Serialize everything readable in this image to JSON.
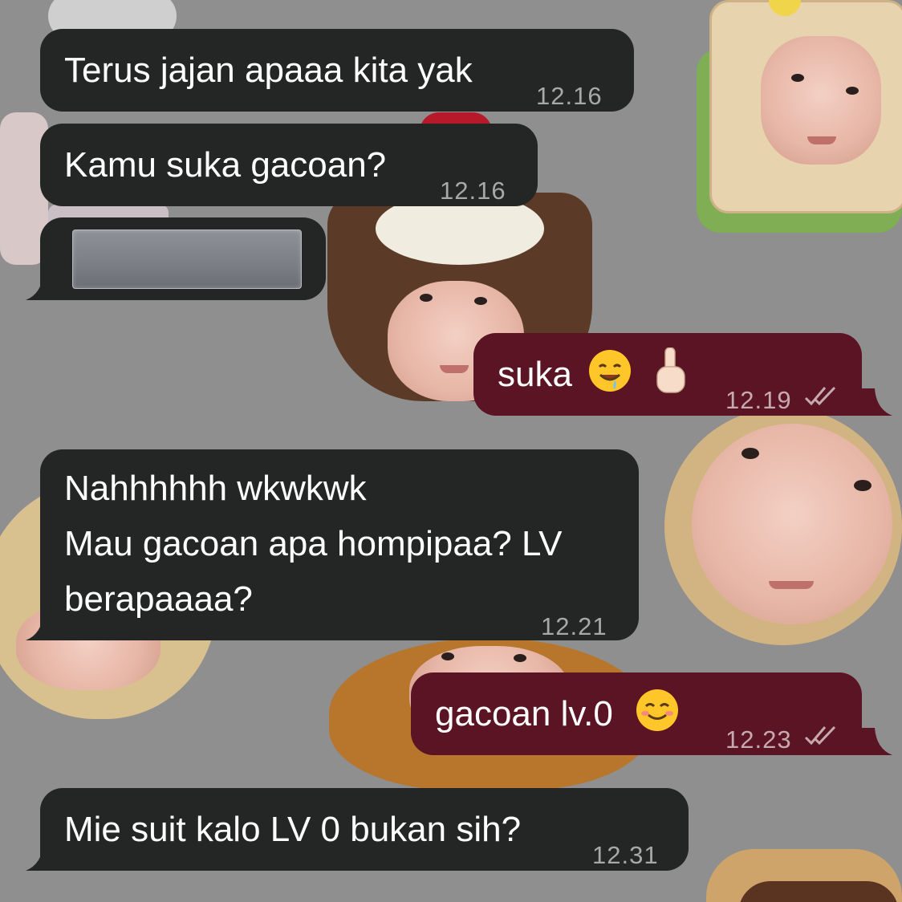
{
  "messages": [
    {
      "id": "m1",
      "direction": "incoming",
      "text": "Terus jajan apaaa kita yak",
      "time": "12.16"
    },
    {
      "id": "m2",
      "direction": "incoming",
      "text": "Kamu suka gacoan?",
      "time": "12.16"
    },
    {
      "id": "m3",
      "direction": "incoming",
      "text": "",
      "time": "",
      "redacted": true
    },
    {
      "id": "m4",
      "direction": "outgoing",
      "text": "suka",
      "emoji": [
        "drooling-face",
        "index-pointing-up"
      ],
      "time": "12.19",
      "status": "read"
    },
    {
      "id": "m5",
      "direction": "incoming",
      "text": "Nahhhhhh wkwkwk\nMau gacoan apa hompipaa? LV\nberapaaaa?",
      "time": "12.21"
    },
    {
      "id": "m6",
      "direction": "outgoing",
      "text": "gacoan lv.0",
      "emoji": [
        "smiling-face"
      ],
      "time": "12.23",
      "status": "read"
    },
    {
      "id": "m7",
      "direction": "incoming",
      "text": "Mie suit kalo LV 0 bukan sih?",
      "time": "12.31"
    }
  ],
  "colors": {
    "incoming_bubble": "#242626",
    "outgoing_bubble": "#5b1423",
    "wallpaper": "#8f8f8f",
    "timestamp": "#a7a9a9"
  },
  "icons": {
    "read_receipt": "double-check-icon",
    "wallpaper": "food-face-stickers"
  }
}
